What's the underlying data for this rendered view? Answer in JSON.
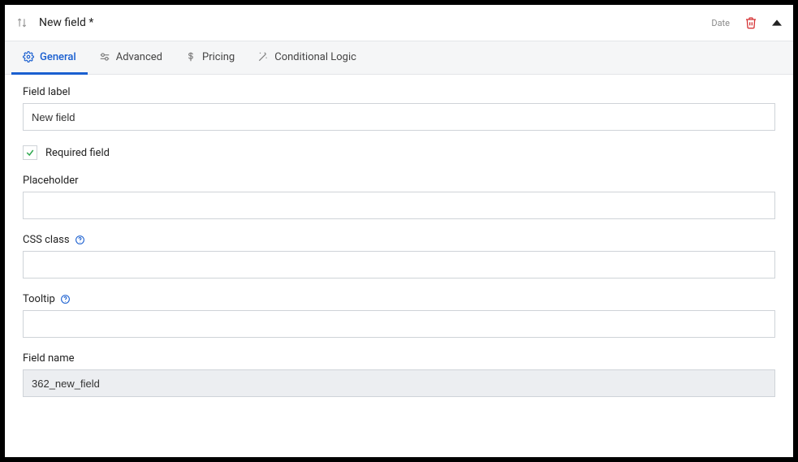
{
  "header": {
    "title": "New field *",
    "type_label": "Date"
  },
  "tabs": {
    "general": "General",
    "advanced": "Advanced",
    "pricing": "Pricing",
    "conditional": "Conditional Logic"
  },
  "form": {
    "field_label": {
      "label": "Field label",
      "value": "New field"
    },
    "required": {
      "label": "Required field",
      "checked": true
    },
    "placeholder": {
      "label": "Placeholder",
      "value": ""
    },
    "css_class": {
      "label": "CSS class",
      "value": ""
    },
    "tooltip": {
      "label": "Tooltip",
      "value": ""
    },
    "field_name": {
      "label": "Field name",
      "value": "362_new_field"
    }
  }
}
